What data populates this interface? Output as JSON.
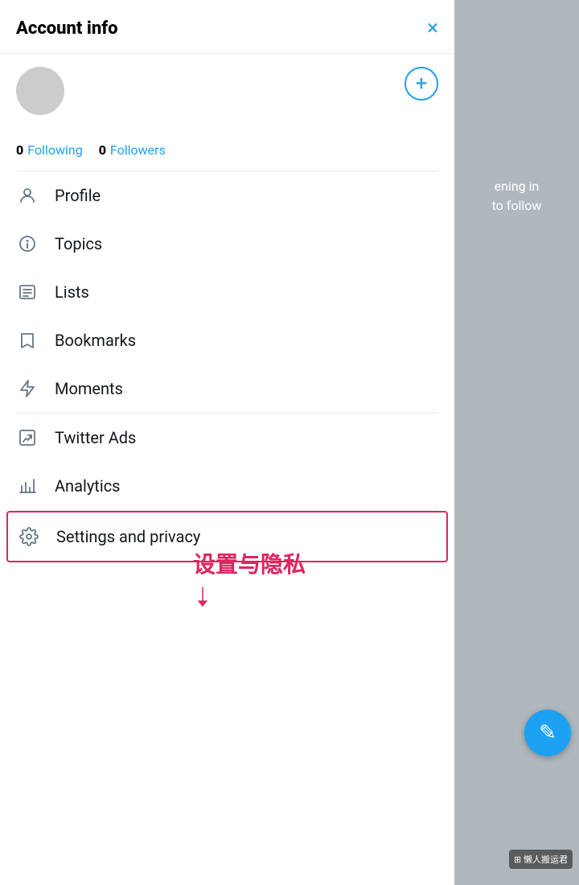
{
  "header": {
    "title": "Account info",
    "close_label": "×"
  },
  "stats": {
    "following_count": "0",
    "following_label": "Following",
    "followers_count": "0",
    "followers_label": "Followers"
  },
  "menu": {
    "items": [
      {
        "id": "profile",
        "label": "Profile",
        "icon": "person-icon"
      },
      {
        "id": "topics",
        "label": "Topics",
        "icon": "topics-icon"
      },
      {
        "id": "lists",
        "label": "Lists",
        "icon": "lists-icon"
      },
      {
        "id": "bookmarks",
        "label": "Bookmarks",
        "icon": "bookmarks-icon"
      },
      {
        "id": "moments",
        "label": "Moments",
        "icon": "moments-icon"
      },
      {
        "id": "twitter-ads",
        "label": "Twitter Ads",
        "icon": "ads-icon"
      },
      {
        "id": "analytics",
        "label": "Analytics",
        "icon": "analytics-icon"
      },
      {
        "id": "settings",
        "label": "Settings and privacy",
        "icon": "settings-icon"
      }
    ]
  },
  "annotation": {
    "text": "设置与隐私"
  },
  "right_panel": {
    "signin_text": "ening in\nto follow"
  },
  "fab": {
    "label": "✎"
  },
  "wechat": {
    "label": "懒人搬运君"
  },
  "add_button_label": "+"
}
